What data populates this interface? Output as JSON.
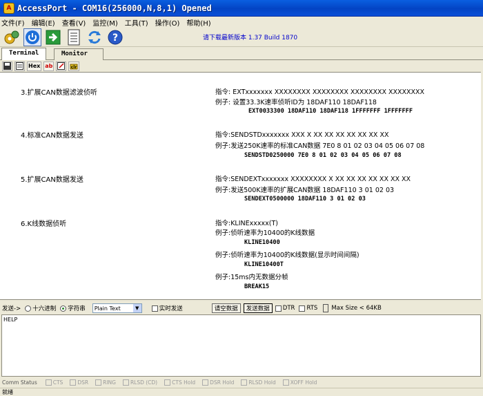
{
  "window": {
    "title": "AccessPort - COM16(256000,N,8,1) Opened"
  },
  "menu": [
    "文件(F)",
    "编辑(E)",
    "查看(V)",
    "监控(M)",
    "工具(T)",
    "操作(O)",
    "帮助(H)"
  ],
  "toolbar": {
    "update_text": "请下载最新版本 1.37 Build 1870"
  },
  "tabs": [
    "Terminal",
    "Monitor"
  ],
  "subtoolbar": {
    "hex": "Hex",
    "ab": "ab"
  },
  "content": {
    "sections": [
      {
        "title": "3.扩展CAN数据滤波侦听",
        "lines": [
          "指令: EXTxxxxxxx XXXXXXXX XXXXXXXX XXXXXXXX XXXXXXXX",
          "例子: 设置33.3K速率侦听ID为 18DAF110 18DAF118",
          "EXT0033300  18DAF110 18DAF118 1FFFFFFF 1FFFFFFF"
        ]
      },
      {
        "title": "4.标准CAN数据发送",
        "lines": [
          "指令:SENDSTDxxxxxxx XXX X XX XX XX XX XX XX XX",
          "例子:发送250K速率的标准CAN数据 7E0 8 01 02 03 04 05 06 07 08",
          "SENDSTD0250000 7E0 8 01 02 03 04 05 06 07 08"
        ]
      },
      {
        "title": "5.扩展CAN数据发送",
        "lines": [
          "指令:SENDEXTxxxxxxx XXXXXXXX X XX XX XX XX XX XX XX",
          "例子:发送500K速率的扩展CAN数据 18DAF110 3 01 02 03",
          "SENDEXT0500000 18DAF110 3 01 02 03"
        ]
      },
      {
        "title": "6.K线数据侦听",
        "lines": [
          "指令:KLINExxxxx(T)",
          "例子:侦听速率为10400的K线数据",
          "KLINE10400",
          "例子:侦听速率为10400的K线数据(显示时间间隔)",
          "KLINE10400T",
          "例子:15ms内无数据分帧",
          "BREAK15"
        ]
      }
    ]
  },
  "sendbar": {
    "label": "发送->",
    "radio_hex": "十六进制",
    "radio_str": "字符串",
    "select_value": "Plain Text",
    "realtime": "实时发送",
    "clear_btn": "请空数据",
    "send_btn": "发送数据",
    "dtr": "DTR",
    "rts": "RTS",
    "maxsize": "Max Size < 64KB"
  },
  "input": {
    "value": "HELP"
  },
  "status": {
    "label": "Comm Status",
    "items": [
      "CTS",
      "DSR",
      "RING",
      "RLSD (CD)",
      "CTS Hold",
      "DSR Hold",
      "RLSD Hold",
      "XOFF Hold"
    ]
  },
  "bottom": {
    "text": "就绪"
  }
}
